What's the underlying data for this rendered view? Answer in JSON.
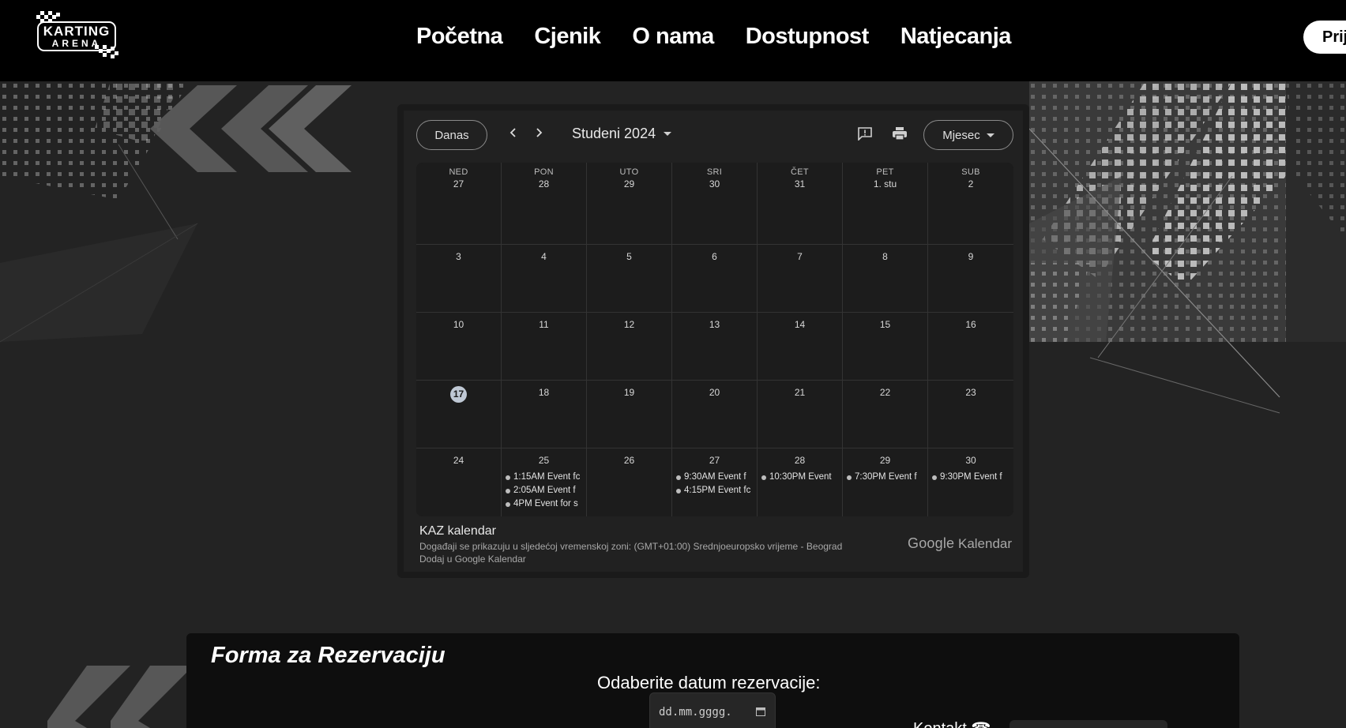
{
  "header": {
    "logo": {
      "line1": "KARTING",
      "line2": "ARENA"
    },
    "nav": [
      "Početna",
      "Cjenik",
      "O nama",
      "Dostupnost",
      "Natjecanja"
    ],
    "login_label": "Prij"
  },
  "calendar": {
    "today_label": "Danas",
    "month_label": "Studeni 2024",
    "view_label": "Mjesec",
    "icons": {
      "prev": "chevron-left-icon",
      "next": "chevron-right-icon",
      "feedback": "feedback-icon",
      "print": "print-icon"
    },
    "weekdays": [
      "NED",
      "PON",
      "UTO",
      "SRI",
      "ČET",
      "PET",
      "SUB"
    ],
    "weeks": [
      [
        {
          "day": "27"
        },
        {
          "day": "28"
        },
        {
          "day": "29"
        },
        {
          "day": "30"
        },
        {
          "day": "31"
        },
        {
          "day": "1. stu"
        },
        {
          "day": "2"
        }
      ],
      [
        {
          "day": "3"
        },
        {
          "day": "4"
        },
        {
          "day": "5"
        },
        {
          "day": "6"
        },
        {
          "day": "7"
        },
        {
          "day": "8"
        },
        {
          "day": "9"
        }
      ],
      [
        {
          "day": "10"
        },
        {
          "day": "11"
        },
        {
          "day": "12"
        },
        {
          "day": "13"
        },
        {
          "day": "14"
        },
        {
          "day": "15"
        },
        {
          "day": "16"
        }
      ],
      [
        {
          "day": "17",
          "today": true
        },
        {
          "day": "18"
        },
        {
          "day": "19"
        },
        {
          "day": "20"
        },
        {
          "day": "21"
        },
        {
          "day": "22"
        },
        {
          "day": "23"
        }
      ],
      [
        {
          "day": "24"
        },
        {
          "day": "25",
          "events": [
            "1:15AM Event fc",
            "2:05AM Event f",
            "4PM Event for s"
          ]
        },
        {
          "day": "26"
        },
        {
          "day": "27",
          "events": [
            "9:30AM Event f",
            "4:15PM Event fc"
          ]
        },
        {
          "day": "28",
          "events": [
            "10:30PM Event"
          ]
        },
        {
          "day": "29",
          "events": [
            "7:30PM Event f"
          ]
        },
        {
          "day": "30",
          "events": [
            "9:30PM Event f"
          ]
        }
      ]
    ],
    "footer": {
      "calendar_name": "KAZ kalendar",
      "timezone_text": "Događaji se prikazuju u sljedećoj vremenskoj zoni: (GMT+01:00) Srednjoeuropsko vrijeme - Beograd",
      "add_link": "Dodaj u Google Kalendar",
      "brand_google": "Google",
      "brand_kalendar": "Kalendar"
    }
  },
  "form": {
    "title": "Forma za Rezervaciju",
    "date_label": "Odaberite datum rezervacije:",
    "date_placeholder": "dd.mm.gggg.",
    "kontakt_label": "Kontakt"
  },
  "colors": {
    "header_bg": "#000000",
    "page_bg": "#232323",
    "form_bg": "#0e0e0e",
    "accent": "#ffffff"
  }
}
